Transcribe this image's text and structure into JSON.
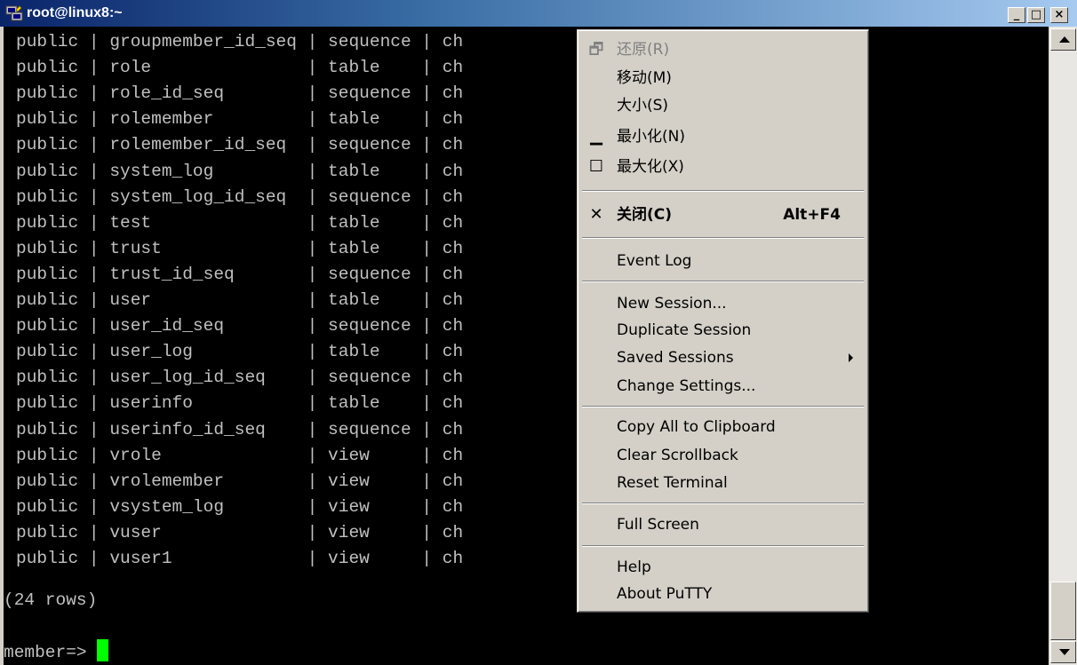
{
  "window": {
    "title": "root@linux8:~",
    "controls": {
      "minimize": "_",
      "maximize": "□",
      "close": "×"
    }
  },
  "terminal": {
    "rows": [
      {
        "schema": "public",
        "name": "groupmember_id_seq",
        "type": "sequence",
        "owner": "ch"
      },
      {
        "schema": "public",
        "name": "role",
        "type": "table",
        "owner": "ch"
      },
      {
        "schema": "public",
        "name": "role_id_seq",
        "type": "sequence",
        "owner": "ch"
      },
      {
        "schema": "public",
        "name": "rolemember",
        "type": "table",
        "owner": "ch"
      },
      {
        "schema": "public",
        "name": "rolemember_id_seq",
        "type": "sequence",
        "owner": "ch"
      },
      {
        "schema": "public",
        "name": "system_log",
        "type": "table",
        "owner": "ch"
      },
      {
        "schema": "public",
        "name": "system_log_id_seq",
        "type": "sequence",
        "owner": "ch"
      },
      {
        "schema": "public",
        "name": "test",
        "type": "table",
        "owner": "ch"
      },
      {
        "schema": "public",
        "name": "trust",
        "type": "table",
        "owner": "ch"
      },
      {
        "schema": "public",
        "name": "trust_id_seq",
        "type": "sequence",
        "owner": "ch"
      },
      {
        "schema": "public",
        "name": "user",
        "type": "table",
        "owner": "ch"
      },
      {
        "schema": "public",
        "name": "user_id_seq",
        "type": "sequence",
        "owner": "ch"
      },
      {
        "schema": "public",
        "name": "user_log",
        "type": "table",
        "owner": "ch"
      },
      {
        "schema": "public",
        "name": "user_log_id_seq",
        "type": "sequence",
        "owner": "ch"
      },
      {
        "schema": "public",
        "name": "userinfo",
        "type": "table",
        "owner": "ch"
      },
      {
        "schema": "public",
        "name": "userinfo_id_seq",
        "type": "sequence",
        "owner": "ch"
      },
      {
        "schema": "public",
        "name": "vrole",
        "type": "view",
        "owner": "ch"
      },
      {
        "schema": "public",
        "name": "vrolemember",
        "type": "view",
        "owner": "ch"
      },
      {
        "schema": "public",
        "name": "vsystem_log",
        "type": "view",
        "owner": "ch"
      },
      {
        "schema": "public",
        "name": "vuser",
        "type": "view",
        "owner": "ch"
      },
      {
        "schema": "public",
        "name": "vuser1",
        "type": "view",
        "owner": "ch"
      }
    ],
    "row_count": "(24 rows)",
    "prompt": "member=> ",
    "cursor_color": "#00ff00"
  },
  "context_menu": {
    "restore": {
      "label": "还原(R)",
      "icon": "restore-icon",
      "glyph": "🗗",
      "disabled": true
    },
    "move": {
      "label": "移动(M)"
    },
    "size": {
      "label": "大小(S)"
    },
    "minimize": {
      "label": "最小化(N)",
      "icon": "minimize-icon",
      "glyph": "▁"
    },
    "maximize": {
      "label": "最大化(X)",
      "icon": "maximize-icon",
      "glyph": "☐"
    },
    "close": {
      "label": "关闭(C)",
      "accelerator": "Alt+F4",
      "icon": "close-icon",
      "glyph": "✕"
    },
    "event_log": {
      "label": "Event Log"
    },
    "new_session": {
      "label": "New Session..."
    },
    "duplicate_session": {
      "label": "Duplicate Session"
    },
    "saved_sessions": {
      "label": "Saved Sessions",
      "submenu": true
    },
    "change_settings": {
      "label": "Change Settings..."
    },
    "copy_all": {
      "label": "Copy All to Clipboard"
    },
    "clear_scrollback": {
      "label": "Clear Scrollback"
    },
    "reset_terminal": {
      "label": "Reset Terminal"
    },
    "full_screen": {
      "label": "Full Screen"
    },
    "help": {
      "label": "Help"
    },
    "about": {
      "label": "About PuTTY"
    }
  },
  "colors": {
    "terminal_bg": "#000000",
    "terminal_fg": "#c0c0c0",
    "titlebar_start": "#0a246a",
    "titlebar_end": "#a6caf0",
    "menu_bg": "#d4d0c8"
  }
}
